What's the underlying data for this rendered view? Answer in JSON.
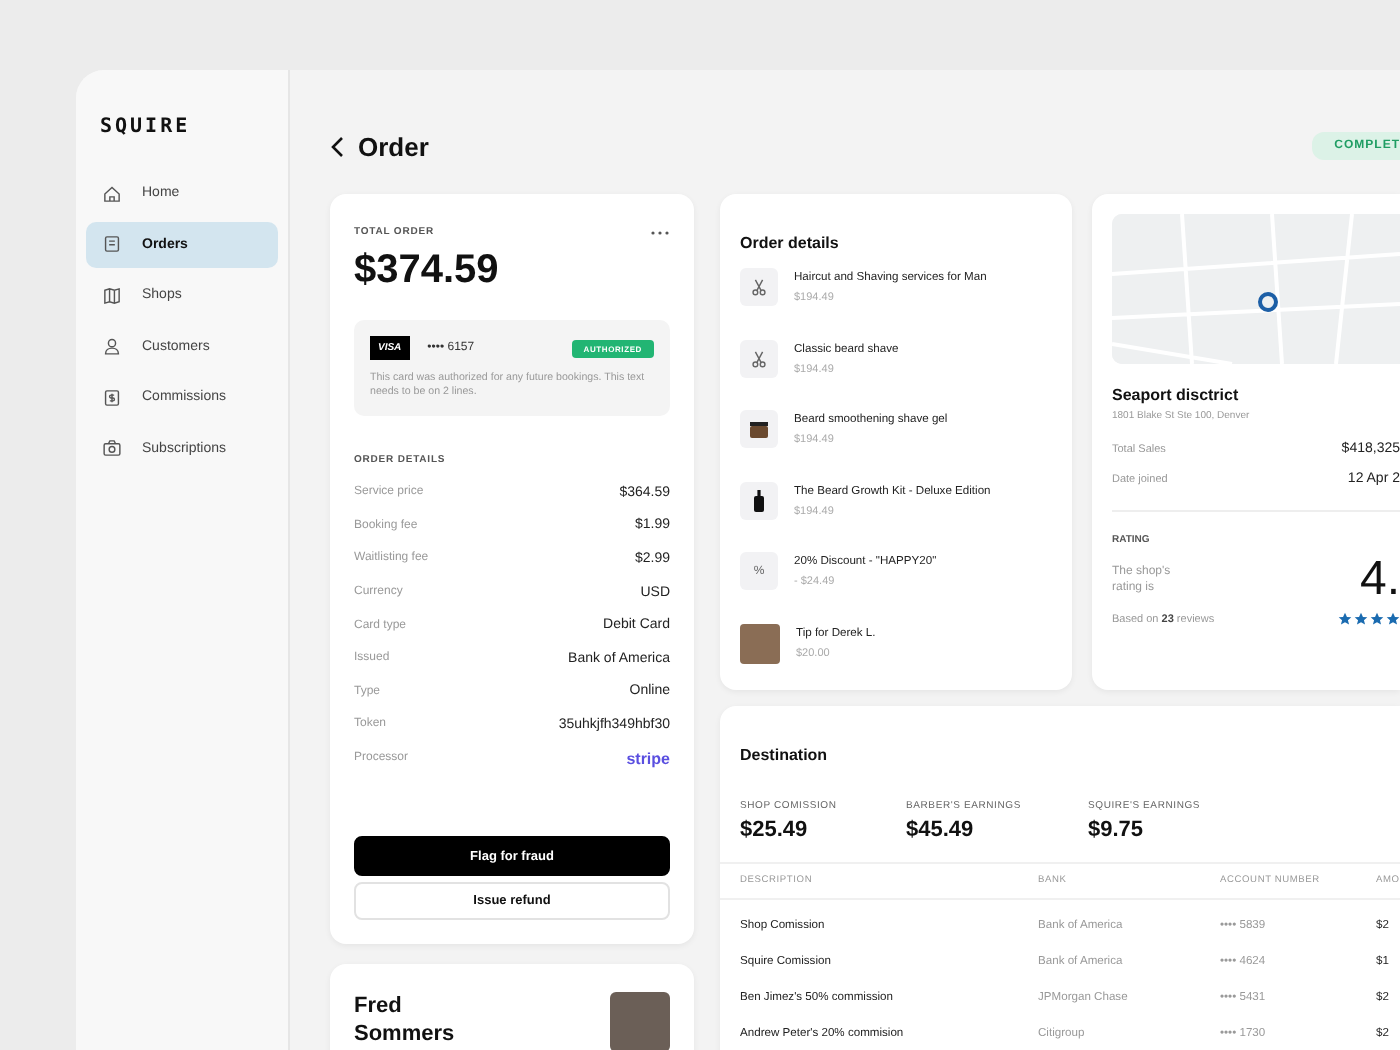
{
  "sidebar": {
    "logo": "SQUIRE",
    "items": [
      {
        "label": "Home",
        "selected": false
      },
      {
        "label": "Orders",
        "selected": true
      },
      {
        "label": "Shops",
        "selected": false
      },
      {
        "label": "Customers",
        "selected": false
      },
      {
        "label": "Commissions",
        "selected": false
      },
      {
        "label": "Subscriptions",
        "selected": false
      }
    ]
  },
  "header": {
    "title": "Order",
    "status": "COMPLET"
  },
  "order_summary": {
    "label": "TOTAL ORDER",
    "total": "$374.59",
    "payment": {
      "brand": "VISA",
      "card_number": "•••• 6157",
      "badge": "AUTHORIZED",
      "note": "This card was authorized for any future bookings. This text needs to be on 2 lines."
    },
    "details_label": "ORDER DETAILS",
    "details": [
      {
        "label": "Service price",
        "value": "$364.59",
        "kind": "text"
      },
      {
        "label": "Booking fee",
        "value": "$1.99",
        "kind": "text"
      },
      {
        "label": "Waitlisting fee",
        "value": "$2.99",
        "kind": "text"
      },
      {
        "label": "Currency",
        "value": "USD",
        "kind": "text"
      },
      {
        "label": "Card type",
        "value": "Debit Card",
        "kind": "text"
      },
      {
        "label": "Issued",
        "value": "Bank of America",
        "kind": "text"
      },
      {
        "label": "Type",
        "value": "Online",
        "kind": "text"
      },
      {
        "label": "Token",
        "value": "35uhkjfh349hbf30",
        "kind": "text"
      },
      {
        "label": "Processor",
        "value": "stripe",
        "kind": "logo"
      }
    ],
    "buttons": [
      {
        "label": "Flag for fraud",
        "kind": "primary"
      },
      {
        "label": "Issue refund",
        "kind": "secondary"
      }
    ]
  },
  "customer": {
    "name": "Fred Sommers"
  },
  "order_items": {
    "title": "Order details",
    "items": [
      {
        "kind": "service",
        "name": "Haircut and Shaving services for Man",
        "price": "$194.49"
      },
      {
        "kind": "service",
        "name": "Classic beard shave",
        "price": "$194.49"
      },
      {
        "kind": "product",
        "name": "Beard smoothening shave gel",
        "price": "$194.49"
      },
      {
        "kind": "product",
        "name": "The Beard Growth Kit - Deluxe Edition",
        "price": "$194.49"
      },
      {
        "kind": "discount",
        "symbol": "%",
        "name": "20% Discount - \"HAPPY20\"",
        "price": "- $24.49"
      },
      {
        "kind": "tip",
        "name": "Tip for Derek L.",
        "price": "$20.00"
      }
    ]
  },
  "shop": {
    "name": "Seaport disctrict",
    "address": "1801 Blake St Ste 100, Denver",
    "stats": [
      {
        "label": "Total Sales",
        "value": "$418,325"
      },
      {
        "label": "Date joined",
        "value": "12 Apr 2"
      }
    ],
    "rating_label": "RATING",
    "rating_text": "The shop's rating is",
    "rating": "4.",
    "reviews": "Based on **23** reviews",
    "stars": 4
  },
  "destination": {
    "title": "Destination",
    "earnings": [
      {
        "label": "SHOP COMISSION",
        "value": "$25.49"
      },
      {
        "label": "BARBER'S EARNINGS",
        "value": "$45.49"
      },
      {
        "label": "SQUIRE'S EARNINGS",
        "value": "$9.75"
      }
    ],
    "columns": [
      "DESCRIPTION",
      "BANK",
      "ACCOUNT NUMBER",
      "AMO"
    ],
    "rows": [
      [
        "Shop Comission",
        "Bank of America",
        "•••• 5839",
        "$2"
      ],
      [
        "Squire Comission",
        "Bank of America",
        "•••• 4624",
        "$1"
      ],
      [
        "Ben Jimez's 50% commission",
        "JPMorgan Chase",
        "•••• 5431",
        "$2"
      ],
      [
        "Andrew Peter's 20% commision",
        "Citigroup",
        "•••• 1730",
        "$2"
      ]
    ]
  }
}
